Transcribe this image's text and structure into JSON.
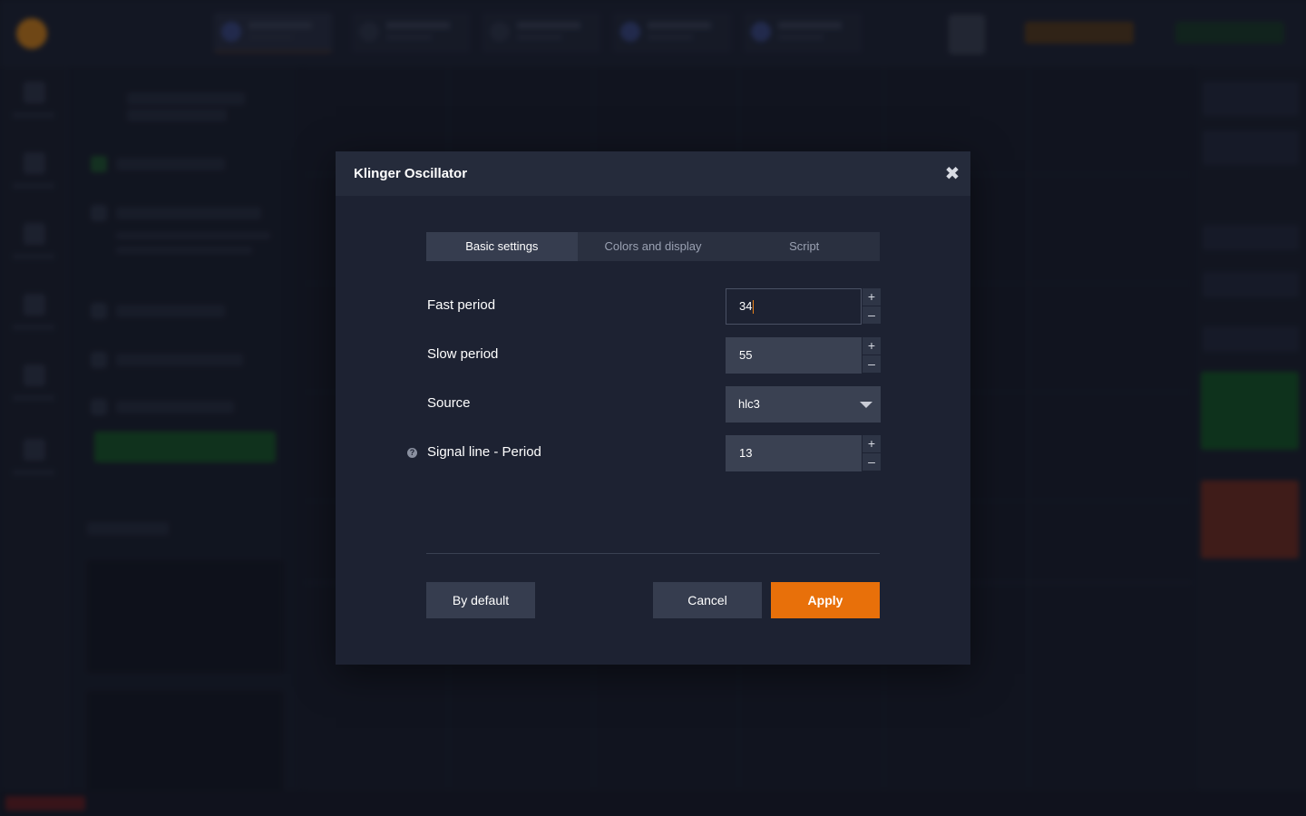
{
  "dialog": {
    "title": "Klinger Oscillator",
    "close_icon": "close-icon",
    "tabs": [
      {
        "label": "Basic settings",
        "active": true
      },
      {
        "label": "Colors and display",
        "active": false
      },
      {
        "label": "Script",
        "active": false
      }
    ],
    "fields": {
      "fast_period": {
        "label": "Fast period",
        "value": "34",
        "focused": true
      },
      "slow_period": {
        "label": "Slow period",
        "value": "55"
      },
      "source": {
        "label": "Source",
        "value": "hlc3"
      },
      "signal_period": {
        "label": "Signal line - Period",
        "value": "13",
        "help_icon": "help-icon",
        "help_glyph": "?"
      }
    },
    "stepper": {
      "plus": "+",
      "minus": "–"
    },
    "buttons": {
      "by_default": "By default",
      "cancel": "Cancel",
      "apply": "Apply"
    }
  },
  "colors": {
    "modal_bg": "#1d2232",
    "header_bg": "#252b3b",
    "input_bg": "#3a4152",
    "accent": "#e8700a"
  }
}
